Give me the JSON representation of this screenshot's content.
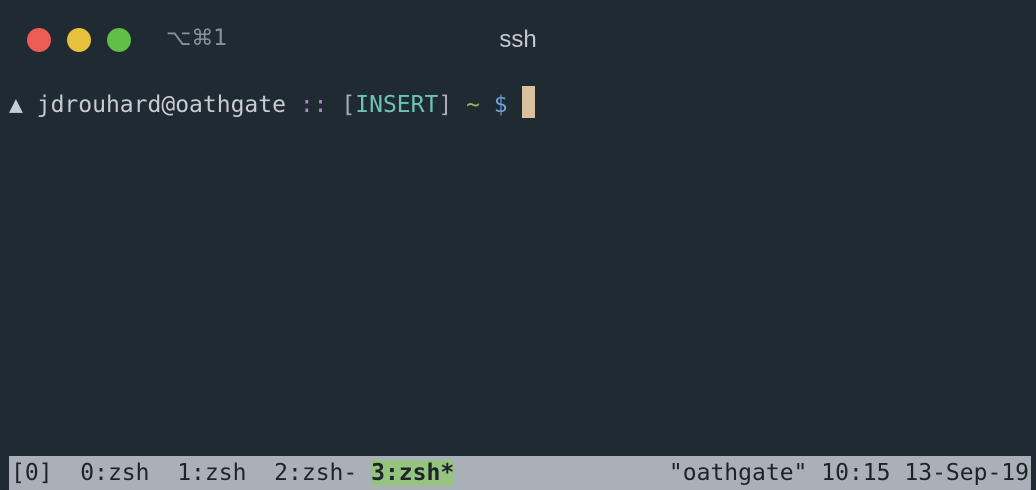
{
  "window": {
    "title": "ssh",
    "shortcut": "⌥⌘1",
    "colors": {
      "background": "#1f2a33",
      "close": "#ee5c57",
      "minimize": "#e5c13c",
      "maximize": "#5fbf47"
    }
  },
  "prompt": {
    "arrow": "▲",
    "user_host": "jdrouhard@oathgate",
    "separator": "::",
    "mode_open": "[",
    "mode": "INSERT",
    "mode_close": "]",
    "cwd": "~",
    "symbol": "$"
  },
  "tmux": {
    "session": "[0]",
    "windows": [
      {
        "label": "0:zsh",
        "active": false
      },
      {
        "label": "1:zsh",
        "active": false
      },
      {
        "label": "2:zsh-",
        "active": false
      },
      {
        "label": "3:zsh*",
        "active": true
      }
    ],
    "hostname": "\"oathgate\"",
    "time": "10:15",
    "date": "13-Sep-19",
    "colors": {
      "bar": "#aab0b7",
      "active_window": "#96c480"
    }
  }
}
